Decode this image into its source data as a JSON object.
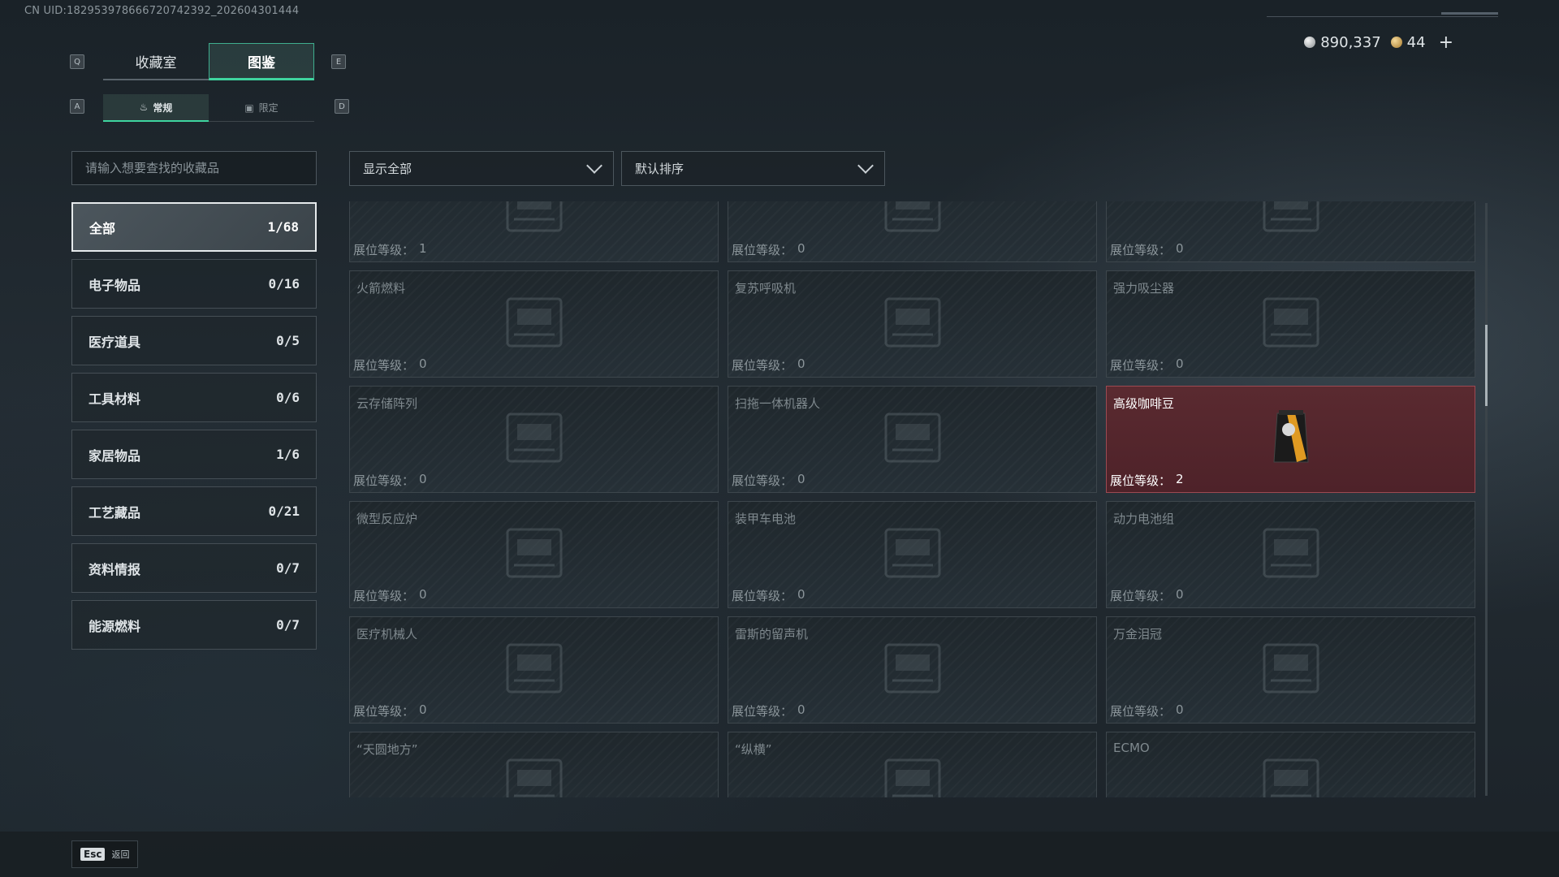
{
  "header": {
    "uid": "CN UID:1829539786667207423​92_202604301444",
    "currency": [
      {
        "icon": "silver-coin-icon",
        "value": "890,337"
      },
      {
        "icon": "gold-coin-icon",
        "value": "44"
      }
    ],
    "plus": "+"
  },
  "keys": {
    "q": "Q",
    "e": "E",
    "a": "A",
    "d": "D"
  },
  "tabs_main": [
    {
      "label": "收藏室",
      "active": false
    },
    {
      "label": "图鉴",
      "active": true
    }
  ],
  "tabs_sub": [
    {
      "label": "常规",
      "active": true
    },
    {
      "label": "限定",
      "active": false
    }
  ],
  "search": {
    "placeholder": "请输入想要查找的收藏品"
  },
  "categories": [
    {
      "label": "全部",
      "count": "1/68",
      "active": true
    },
    {
      "label": "电子物品",
      "count": "0/16"
    },
    {
      "label": "医疗道具",
      "count": "0/5"
    },
    {
      "label": "工具材料",
      "count": "0/6"
    },
    {
      "label": "家居物品",
      "count": "1/6"
    },
    {
      "label": "工艺藏品",
      "count": "0/21"
    },
    {
      "label": "资料情报",
      "count": "0/7"
    },
    {
      "label": "能源燃料",
      "count": "0/7"
    }
  ],
  "filters": {
    "show": "显示全部",
    "sort": "默认排序"
  },
  "level_label": "展位等级：",
  "items": [
    {
      "name": "",
      "level": "1"
    },
    {
      "name": "",
      "level": "0"
    },
    {
      "name": "",
      "level": "0"
    },
    {
      "name": "火箭燃料",
      "level": "0"
    },
    {
      "name": "复苏呼吸机",
      "level": "0"
    },
    {
      "name": "强力吸尘器",
      "level": "0"
    },
    {
      "name": "云存储阵列",
      "level": "0"
    },
    {
      "name": "扫拖一体机器人",
      "level": "0"
    },
    {
      "name": "高级咖啡豆",
      "level": "2",
      "highlight": true
    },
    {
      "name": "微型反应炉",
      "level": "0"
    },
    {
      "name": "装甲车电池",
      "level": "0"
    },
    {
      "name": "动力电池组",
      "level": "0"
    },
    {
      "name": "医疗机械人",
      "level": "0"
    },
    {
      "name": "雷斯的留声机",
      "level": "0"
    },
    {
      "name": "万金泪冠",
      "level": "0"
    },
    {
      "name": "“天圆地方”",
      "level": ""
    },
    {
      "name": "“纵横”",
      "level": ""
    },
    {
      "name": "ECMO",
      "level": ""
    }
  ],
  "footer": {
    "esc": "Esc",
    "back": "返回"
  }
}
